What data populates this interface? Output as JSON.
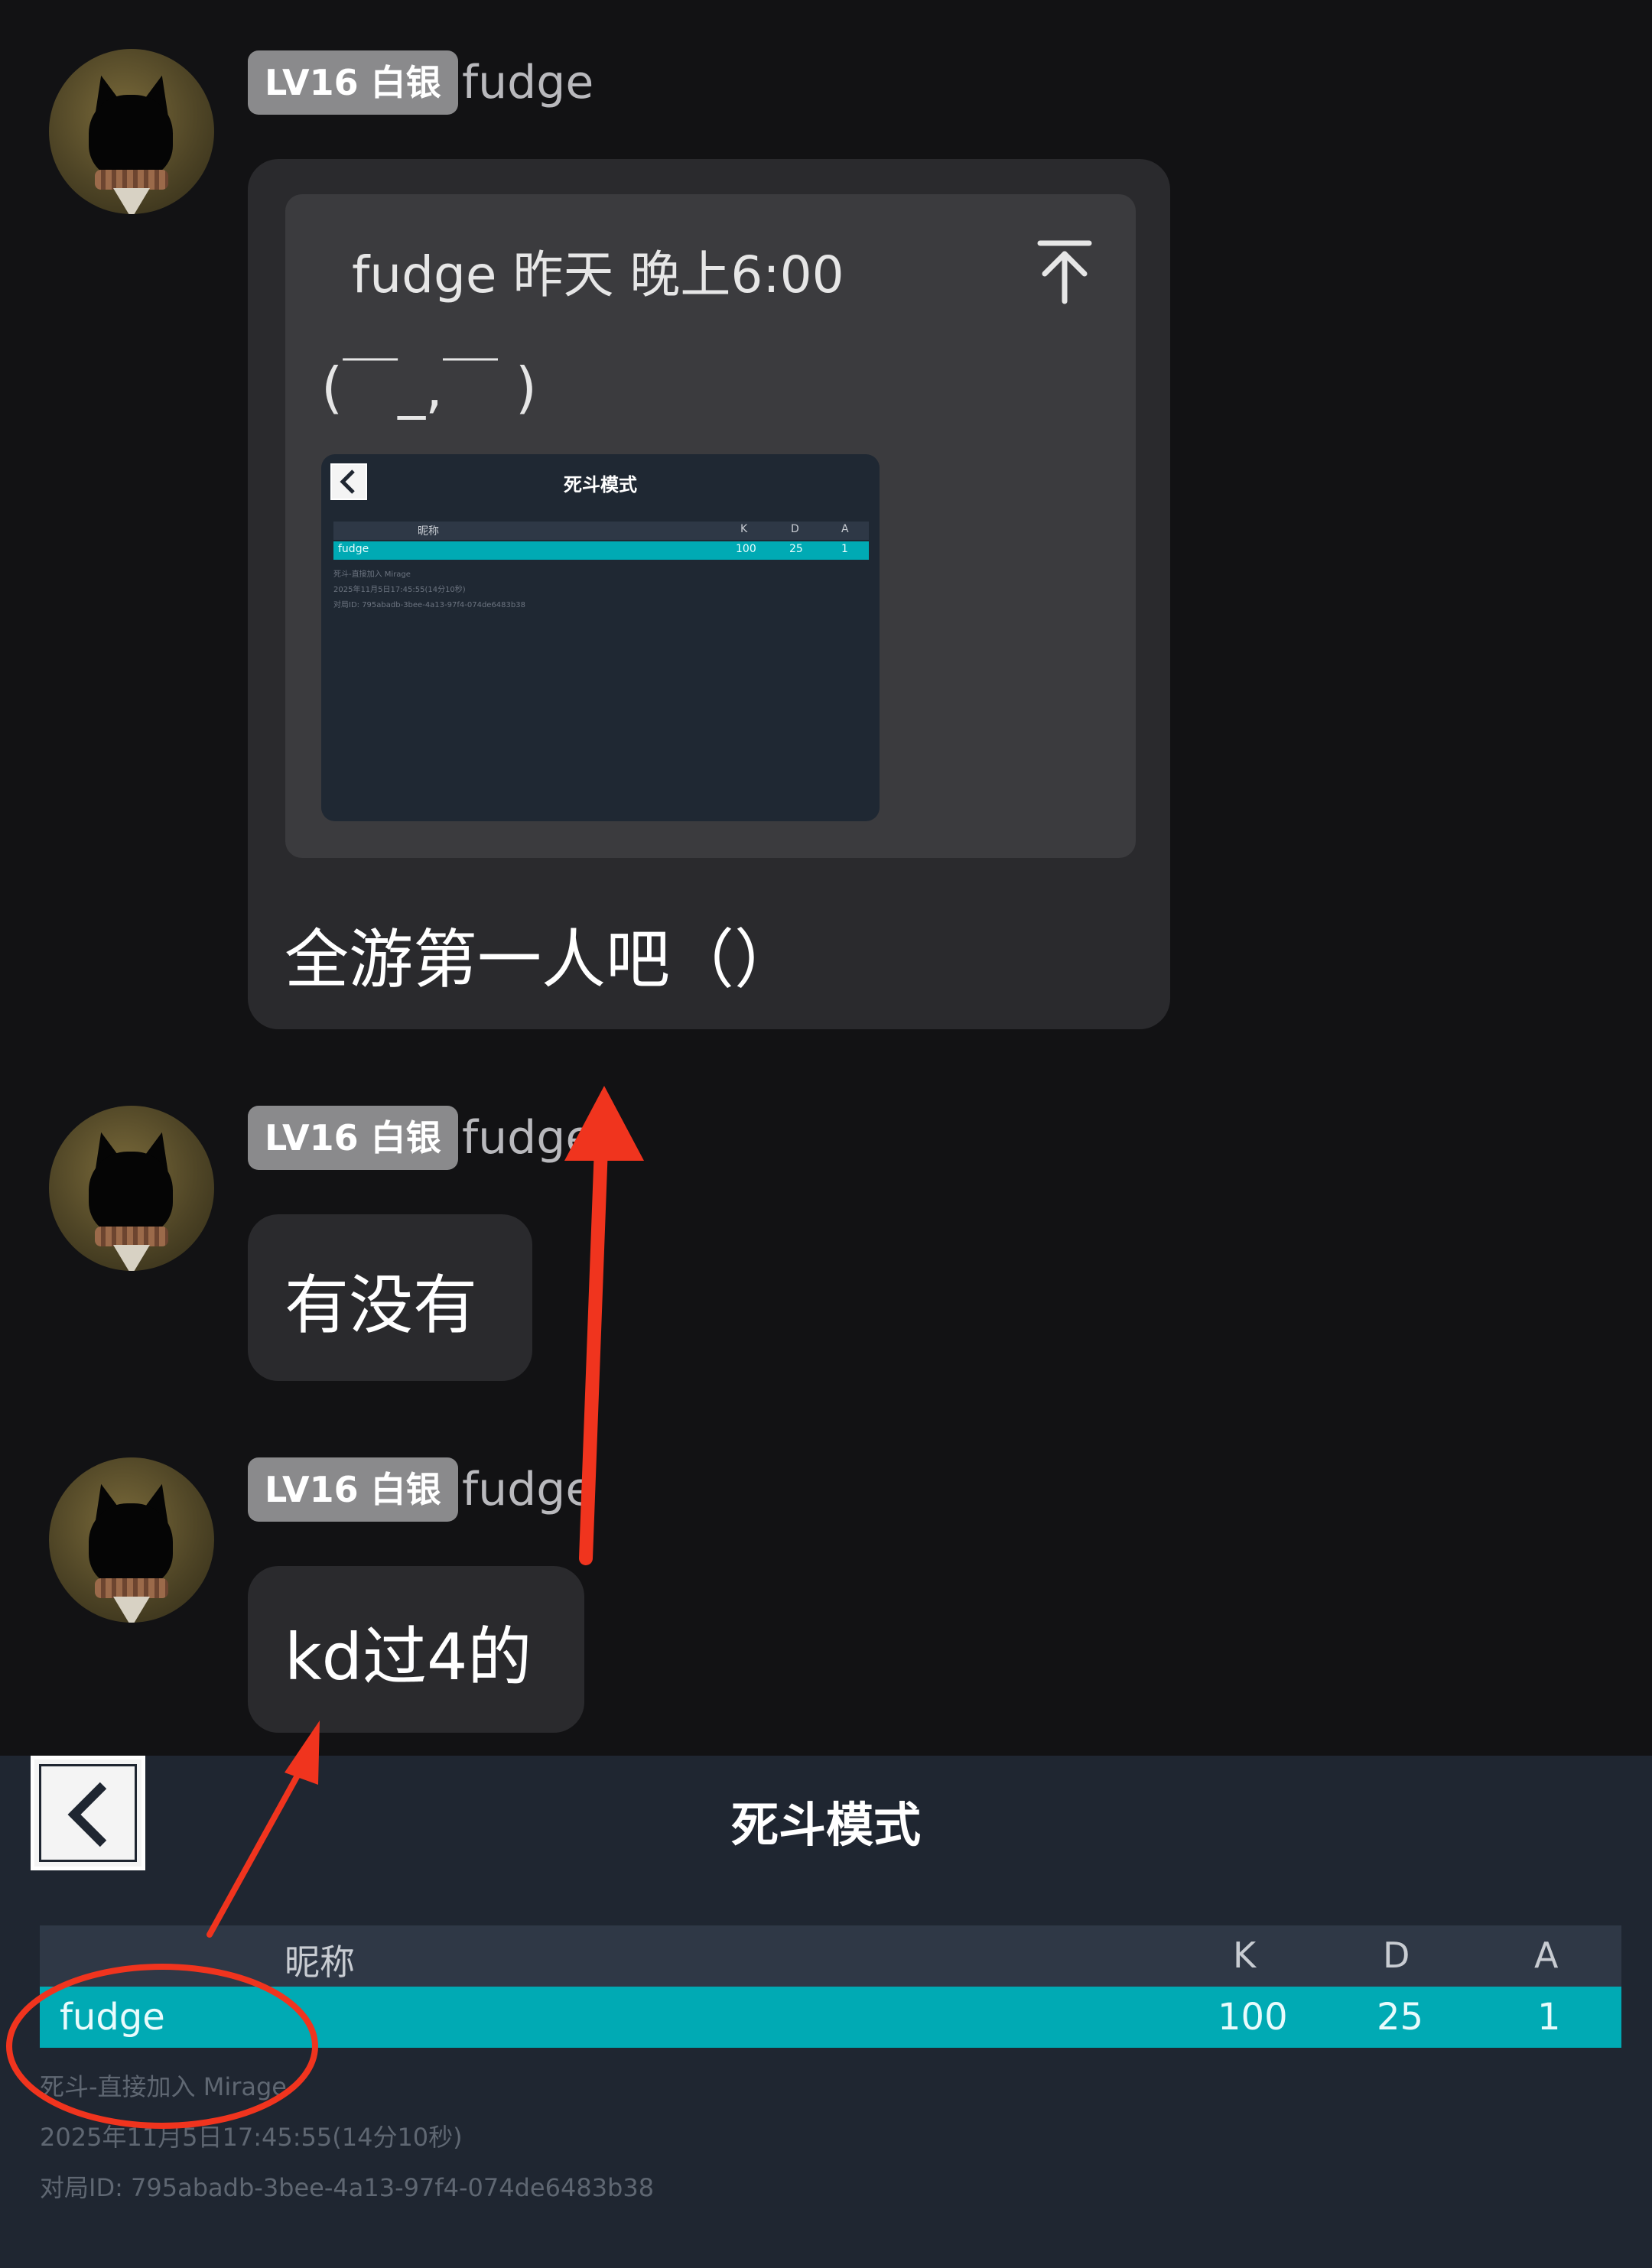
{
  "messages": [
    {
      "badge": "LV16 白银",
      "username": "fudge",
      "quote": {
        "header": "fudge 昨天 晚上6:00",
        "emoticon": "(￣_,￣ )",
        "thumbnail": {
          "title": "死斗模式",
          "col_name": "昵称",
          "col_k": "K",
          "col_d": "D",
          "col_a": "A",
          "row_name": "fudge",
          "row_k": "100",
          "row_d": "25",
          "row_a": "1",
          "info1": "死斗-直接加入 Mirage",
          "info2": "2025年11月5日17:45:55(14分10秒)",
          "info3": "对局ID: 795abadb-3bee-4a13-97f4-074de6483b38"
        }
      },
      "text": "全游第一人吧（）"
    },
    {
      "badge": "LV16 白银",
      "username": "fudge",
      "text": "有没有"
    },
    {
      "badge": "LV16 白银",
      "username": "fudge",
      "text": "kd过4的"
    }
  ],
  "scoreboard": {
    "title": "死斗模式",
    "columns": {
      "name": "昵称",
      "k": "K",
      "d": "D",
      "a": "A"
    },
    "rows": [
      {
        "name": "fudge",
        "k": "100",
        "d": "25",
        "a": "1"
      }
    ],
    "mode_info": "死斗-直接加入 Mirage",
    "datetime": "2025年11月5日17:45:55(14分10秒)",
    "match_id": "对局ID: 795abadb-3bee-4a13-97f4-074de6483b38"
  },
  "colors": {
    "background": "#121214",
    "bubble": "#2a2a2d",
    "highlight_row": "#00aab4",
    "annotation_red": "#f0341e"
  },
  "icons": [
    "avatar-image",
    "scroll-to-top-icon",
    "back-arrow-icon",
    "red-annotation-arrow",
    "red-annotation-circle"
  ]
}
